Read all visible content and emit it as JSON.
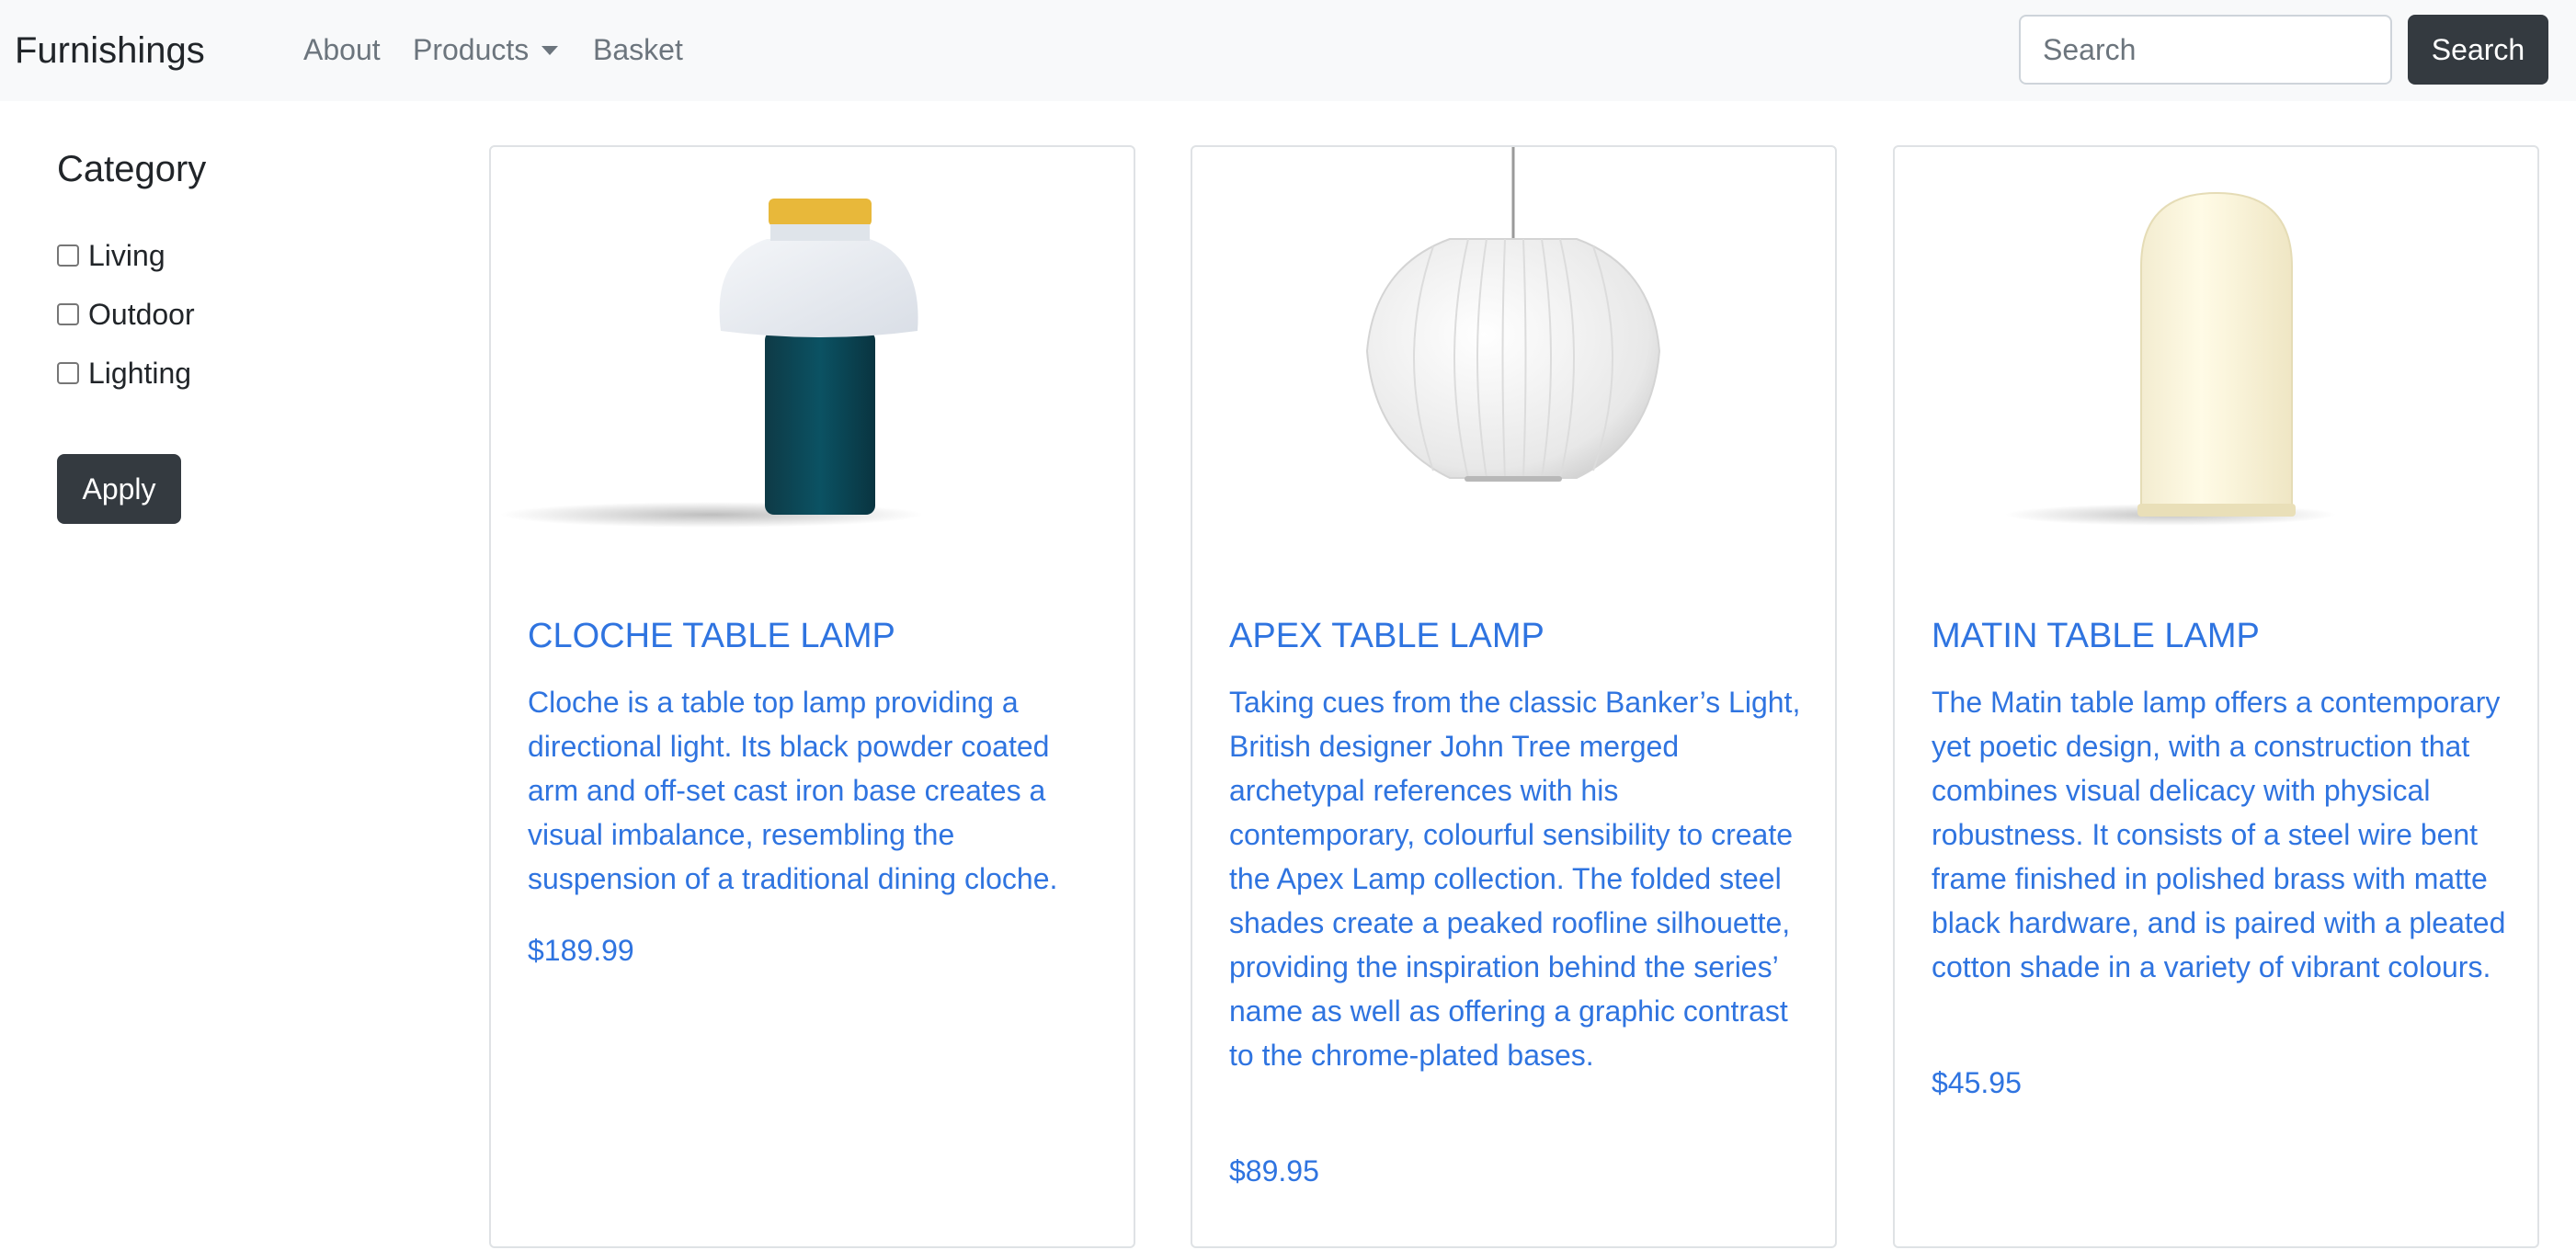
{
  "navbar": {
    "brand": "Furnishings",
    "links": [
      {
        "label": "About"
      },
      {
        "label": "Products"
      },
      {
        "label": "Basket"
      }
    ],
    "search": {
      "placeholder": "Search",
      "value": ""
    },
    "search_button": "Search"
  },
  "sidebar": {
    "title": "Category",
    "categories": [
      {
        "label": "Living",
        "checked": false
      },
      {
        "label": "Outdoor",
        "checked": false
      },
      {
        "label": "Lighting",
        "checked": false
      }
    ],
    "apply_button": "Apply"
  },
  "products": [
    {
      "title": "CLOCHE TABLE LAMP",
      "description": "Cloche is a table top lamp providing a directional light. Its black powder coated arm and off-set cast iron base creates a visual imbalance, resembling the suspension of a traditional dining cloche.",
      "price": "$189.99"
    },
    {
      "title": "APEX TABLE LAMP",
      "description": "Taking cues from the classic Banker’s Light, British designer John Tree merged archetypal references with his contemporary, colourful sensibility to create the Apex Lamp collection. The folded steel shades create a peaked roofline silhouette, providing the inspiration behind the series’ name as well as offering a graphic contrast to the chrome-plated bases.",
      "price": "$89.95"
    },
    {
      "title": "MATIN TABLE LAMP",
      "description": "The Matin table lamp offers a contemporary yet poetic design, with a construction that combines visual delicacy with physical robustness. It consists of a steel wire bent frame finished in polished brass with matte black hardware, and is paired with a pleated cotton shade in a variety of vibrant colours.",
      "price": "$45.95"
    }
  ],
  "colors": {
    "navbar_bg": "#f8f9fa",
    "dark_button": "#343a40",
    "link_blue": "#2f74e0",
    "nav_link": "#6c757d"
  },
  "icons": {
    "products_dropdown": "chevron-down-icon"
  }
}
